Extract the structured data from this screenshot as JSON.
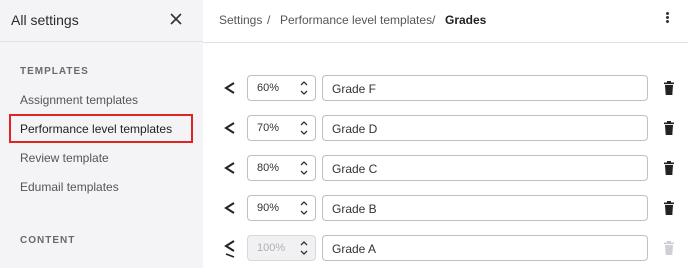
{
  "sidebar": {
    "title": "All settings",
    "section_templates": "TEMPLATES",
    "items": [
      {
        "label": "Assignment templates"
      },
      {
        "label": "Performance level templates"
      },
      {
        "label": "Review template"
      },
      {
        "label": "Edumail templates"
      }
    ],
    "section_content": "CONTENT"
  },
  "breadcrumb": {
    "items": [
      "Settings",
      "Performance level templates",
      "Grades"
    ],
    "separator": "/"
  },
  "levels": [
    {
      "operator": "<",
      "percent": "60%",
      "grade": "Grade F",
      "disabled": false
    },
    {
      "operator": "<",
      "percent": "70%",
      "grade": "Grade D",
      "disabled": false
    },
    {
      "operator": "<",
      "percent": "80%",
      "grade": "Grade C",
      "disabled": false
    },
    {
      "operator": "<",
      "percent": "90%",
      "grade": "Grade B",
      "disabled": false
    },
    {
      "operator": "≤",
      "percent": "100%",
      "grade": "Grade A",
      "disabled": true
    }
  ],
  "colors": {
    "active_outline": "#e02424",
    "sidebar_bg": "#f4f4f6"
  }
}
